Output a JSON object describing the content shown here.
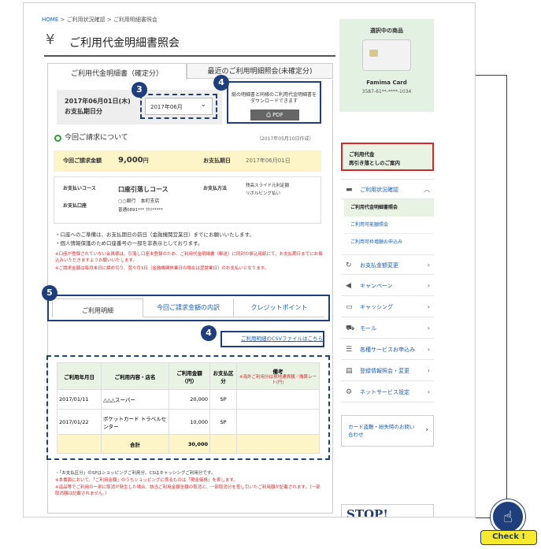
{
  "breadcrumb": {
    "home": "HOME",
    "sep1": ">",
    "item1": "ご利用状況確認",
    "sep2": ">",
    "item2": "ご利用明細書照会"
  },
  "page_title": {
    "icon": "yen-icon",
    "text": "ご利用代金明細書照会"
  },
  "tabs": [
    {
      "label": "ご利用代金明細書（確定分）"
    },
    {
      "label": "最近のご利用明細照会(未確定分)"
    }
  ],
  "date_panel": {
    "date": "2017年06月01日(木)",
    "caption": "お支払期日分",
    "select_value": "2017年06月"
  },
  "pdf_panel": {
    "text": "紙の明細書と同様のご利用代金明細書をダウンロードできます",
    "button": "PDF"
  },
  "badges": {
    "b3": "3",
    "b4a": "4",
    "b5": "5",
    "b4b": "4"
  },
  "billing": {
    "heading": "今回ご請求について",
    "created": "（2017年05月10日作成）",
    "amount_label": "今回ご請求金額",
    "amount_value": "9,000",
    "amount_unit": "円",
    "due_label": "お支払期日",
    "due_value": "2017年06月01日",
    "course_label": "お支払いコース",
    "course_value": "口座引落しコース",
    "bank": "○○銀行　本町支店",
    "account": "普通0891*** ｳｹｲ*****",
    "account_label": "お支払口座",
    "method_label": "お支払方法",
    "method_line1": "残高スライド元利定額",
    "method_line2": "リボルビング払い"
  },
  "notes1": [
    "・口座へのご準備は、お支払期日の前日（金融機関営業日）までにお願いいたします。",
    "・個人情報保護のため口座番号の一部を非表示としております。"
  ],
  "notes1_red": [
    "※口座が登録されていない会員様は、引落し口座未登録のため、ご利用代金明細書（郵送）に同封の振込用紙にて、お支払期日までにお振込みいただきますようお願いいたします。",
    "※ご請求金額は毎月末日に締め切り、翌々月1日（金融機関休業日の場合は翌営業日）のお支払いとなります。"
  ],
  "sub_tabs": [
    "ご利用明細",
    "今回ご請求金額の内訳",
    "クレジットポイント"
  ],
  "csv_link": "ご利用明細のCSVファイルはこちら",
  "table": {
    "headers": [
      "ご利用年月日",
      "ご利用内容・店名",
      "ご利用金額（円）",
      "お支払区分",
      "備考"
    ],
    "remark_note": "※海外ご利用分は現地通貨額／換算レート(円)",
    "rows": [
      {
        "date": "2017/01/11",
        "shop": "△△△スーパー",
        "amount": "20,000",
        "kind": "SP"
      },
      {
        "date": "2017/01/22",
        "shop": "ポケットカード トラベルセンター",
        "amount": "10,000",
        "kind": "SP"
      }
    ],
    "total_label": "合計",
    "total_value": "30,000"
  },
  "notes2": [
    "・「お支払区分」のSPはショッピングご利用分、CSはキャッシングご利用分です。",
    "※本書面において、「ご利用金額」のうちショッピングに係るものは「現金価格」を表します。",
    "※返品等でご利用の一部に取消が発生した場合、該当ご利用金額全額の取消と、一部取消分を差し引いたご利用額が記載されます。（一部取消額は記載されません。）"
  ],
  "card_panel": {
    "heading": "選択中の商品",
    "name": "Famima Card",
    "number": "3587-61**-****-1034"
  },
  "notice": {
    "line1": "ご利用代金",
    "line2": "再引き落としのご案内"
  },
  "sidebar": {
    "usage": {
      "label": "ご利用状況確認",
      "icon": "card-icon",
      "sub": [
        "ご利用代金明細書照会",
        "ご利用可能額照会",
        "ご利用可枠増額お申込み"
      ]
    },
    "items": [
      {
        "label": "お支払金額変更",
        "icon": "refresh-icon"
      },
      {
        "label": "キャンペーン",
        "icon": "megaphone-icon"
      },
      {
        "label": "キャッシング",
        "icon": "wallet-icon"
      },
      {
        "label": "モール",
        "icon": "cart-icon"
      },
      {
        "label": "各種サービスお申込み",
        "icon": "list-icon"
      },
      {
        "label": "登録情報照会・変更",
        "icon": "document-icon"
      },
      {
        "label": "ネットサービス設定",
        "icon": "gear-icon"
      }
    ],
    "lost_card": {
      "line1": "カード盗難・紛失時のお問い",
      "line2": "合わせ"
    },
    "banner": "STOP!"
  },
  "check_button": {
    "label": "Check !",
    "icon": "pointer-hand-icon"
  },
  "colors": {
    "accent": "#1a5eb8",
    "badge": "#1e3f7c",
    "green": "#2e9a3c",
    "highlight": "#fdf5c8",
    "check_yellow": "#f7e830"
  }
}
